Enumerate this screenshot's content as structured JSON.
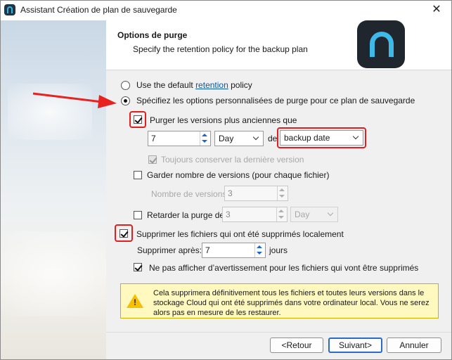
{
  "window": {
    "title": "Assistant Création de plan de sauvegarde"
  },
  "header": {
    "title": "Options de purge",
    "subtitle": "Specify the retention policy for the backup plan"
  },
  "options": {
    "default_radio": {
      "prefix": "Use the default ",
      "link": "retention",
      "suffix": " policy",
      "selected": false
    },
    "custom_radio": {
      "label": "Spécifiez les options personnalisées de purge pour ce plan de sauvegarde",
      "selected": true
    },
    "purge_older": {
      "label": "Purger les versions plus anciennes que",
      "checked": true,
      "value": "7",
      "unit": "Day",
      "of_label": "de",
      "basis": "backup date"
    },
    "always_keep_last": {
      "label": "Toujours conserver la dernière version",
      "checked": true,
      "disabled": true
    },
    "keep_versions": {
      "label": "Garder nombre de versions (pour chaque fichier)",
      "checked": false,
      "count_label": "Nombre de versions:",
      "count_value": "3"
    },
    "delay_purge": {
      "label": "Retarder la purge de:",
      "checked": false,
      "value": "3",
      "unit": "Day"
    },
    "delete_local": {
      "label": "Supprimer les fichiers qui ont été supprimés localement",
      "checked": true,
      "after_label": "Supprimer après:",
      "after_value": "7",
      "after_unit": "jours"
    },
    "no_warning": {
      "label": "Ne pas afficher d’avertissement pour les fichiers qui vont être supprimés",
      "checked": true
    }
  },
  "warning": {
    "icon": "warning-triangle-icon",
    "text": "Cela supprimera définitivement tous les fichiers et toutes leurs versions dans le stockage Cloud qui ont été supprimés dans votre ordinateur local. Vous ne serez alors pas en mesure de les restaurer."
  },
  "footer": {
    "back": "<Retour",
    "next": "Suivant>",
    "cancel": "Annuler"
  },
  "colors": {
    "highlight": "#e02020",
    "arrow": "#e8231f",
    "link": "#0b57a8",
    "warning_bg": "#fff8bf",
    "logo_accent": "#3fb9e8"
  }
}
